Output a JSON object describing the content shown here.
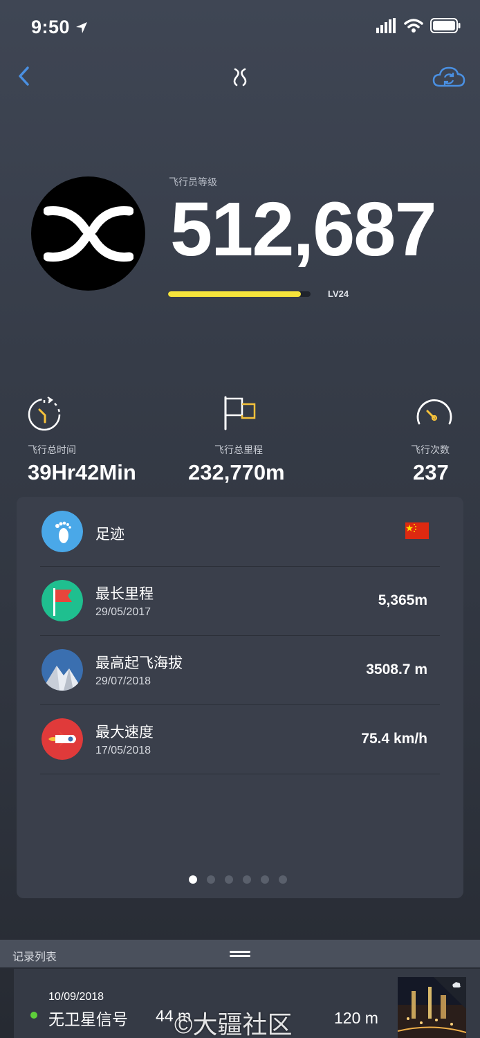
{
  "status_bar": {
    "time": "9:50"
  },
  "profile": {
    "rank_label": "飞行员等级",
    "points": "512,687",
    "level": "LV24",
    "level_progress": 0.93
  },
  "stats": [
    {
      "icon": "stopwatch-icon",
      "label": "飞行总时间",
      "value": "39Hr42Min"
    },
    {
      "icon": "flag-icon",
      "label": "飞行总里程",
      "value": "232,770m"
    },
    {
      "icon": "speedometer-icon",
      "label": "飞行次数",
      "value": "237"
    }
  ],
  "records": [
    {
      "icon": "footprint-icon",
      "title": "足迹",
      "color": "#4aa8e8"
    },
    {
      "icon": "red-flag-icon",
      "title": "最长里程",
      "date": "29/05/2017",
      "value": "5,365m",
      "color": "#1fbf8f"
    },
    {
      "icon": "mountain-icon",
      "title": "最高起飞海拔",
      "date": "29/07/2018",
      "value": "3508.7 m",
      "color": "#3a6fb0"
    },
    {
      "icon": "rocket-icon",
      "title": "最大速度",
      "date": "17/05/2018",
      "value": "75.4 km/h",
      "color": "#e03a3a"
    }
  ],
  "pagination": {
    "pages": 6,
    "active": 0
  },
  "record_list": {
    "title": "记录列表",
    "items": [
      {
        "date": "10/09/2018",
        "status": "无卫星信号",
        "distance": "44 m",
        "altitude": "120 m"
      }
    ]
  },
  "watermark": "©大疆社区",
  "colors": {
    "accent_yellow": "#f6e43b",
    "link_blue": "#4a90e2",
    "status_green": "#5ecf3a"
  }
}
